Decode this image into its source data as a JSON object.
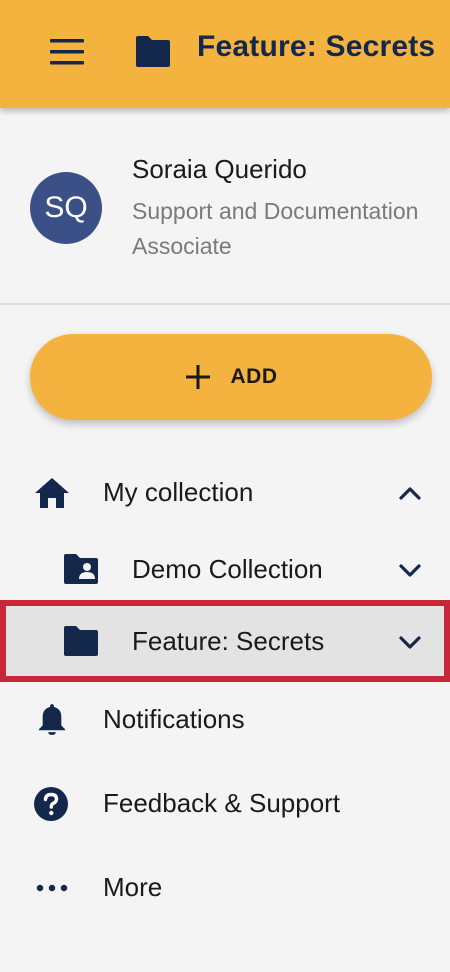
{
  "header": {
    "title": "Feature: Secrets",
    "menu_icon": "hamburger-menu-icon",
    "folder_icon": "folder-icon"
  },
  "profile": {
    "initials": "SQ",
    "name": "Soraia Querido",
    "role": "Support and Documentation Associate"
  },
  "add_button": {
    "label": "ADD",
    "icon": "plus-icon"
  },
  "nav": {
    "my_collection": {
      "label": "My collection",
      "icon": "home-icon",
      "expanded": true
    },
    "demo_collection": {
      "label": "Demo Collection",
      "icon": "shared-folder-icon"
    },
    "feature_secrets": {
      "label": "Feature: Secrets",
      "icon": "folder-icon",
      "selected": true
    },
    "notifications": {
      "label": "Notifications",
      "icon": "bell-icon"
    },
    "feedback": {
      "label": "Feedback & Support",
      "icon": "help-circle-icon"
    },
    "more": {
      "label": "More",
      "icon": "more-horizontal-icon"
    }
  },
  "colors": {
    "accent": "#f4b23e",
    "navy": "#14284b",
    "avatar": "#3c5088",
    "selection_border": "#c8263a",
    "background": "#f4f4f4"
  }
}
